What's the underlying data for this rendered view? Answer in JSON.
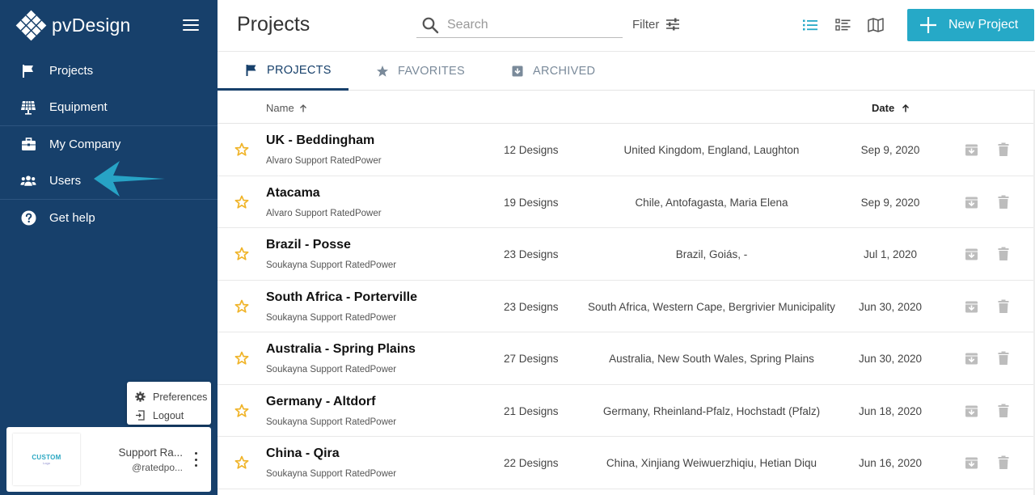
{
  "app": {
    "brand": "pvDesign"
  },
  "sidebar": {
    "items": [
      {
        "label": "Projects",
        "icon": "flag-icon"
      },
      {
        "label": "Equipment",
        "icon": "solar-panel-icon"
      },
      {
        "label": "My Company",
        "icon": "briefcase-icon"
      },
      {
        "label": "Users",
        "icon": "users-icon"
      },
      {
        "label": "Get help",
        "icon": "help-icon"
      }
    ],
    "pref_menu": {
      "preferences": "Preferences",
      "logout": "Logout"
    },
    "user": {
      "logo_text": "CUSTOM",
      "logo_sub": "Logo",
      "name": "Support Ra...",
      "email": "@ratedpo..."
    }
  },
  "header": {
    "title": "Projects",
    "search_placeholder": "Search",
    "filter_label": "Filter",
    "new_project_label": "New Project"
  },
  "tabs": [
    {
      "label": "PROJECTS",
      "active": true
    },
    {
      "label": "FAVORITES",
      "active": false
    },
    {
      "label": "ARCHIVED",
      "active": false
    }
  ],
  "table": {
    "columns": {
      "name": "Name",
      "date": "Date"
    },
    "rows": [
      {
        "name": "UK - Beddingham",
        "owner": "Alvaro Support RatedPower",
        "designs": "12 Designs",
        "location": "United Kingdom, England, Laughton",
        "date": "Sep 9, 2020"
      },
      {
        "name": "Atacama",
        "owner": "Alvaro Support RatedPower",
        "designs": "19 Designs",
        "location": "Chile, Antofagasta, Maria Elena",
        "date": "Sep 9, 2020"
      },
      {
        "name": "Brazil - Posse",
        "owner": "Soukayna Support RatedPower",
        "designs": "23 Designs",
        "location": "Brazil, Goiás, -",
        "date": "Jul 1, 2020"
      },
      {
        "name": "South Africa - Porterville",
        "owner": "Soukayna Support RatedPower",
        "designs": "23 Designs",
        "location": "South Africa, Western Cape, Bergrivier Municipality",
        "date": "Jun 30, 2020"
      },
      {
        "name": "Australia - Spring Plains",
        "owner": "Soukayna Support RatedPower",
        "designs": "27 Designs",
        "location": "Australia, New South Wales, Spring Plains",
        "date": "Jun 30, 2020"
      },
      {
        "name": "Germany - Altdorf",
        "owner": "Soukayna Support RatedPower",
        "designs": "21 Designs",
        "location": "Germany, Rheinland-Pfalz, Hochstadt (Pfalz)",
        "date": "Jun 18, 2020"
      },
      {
        "name": "China - Qira",
        "owner": "Soukayna Support RatedPower",
        "designs": "22 Designs",
        "location": "China, Xinjiang Weiwuerzhiqiu, Hetian Diqu",
        "date": "Jun 16, 2020"
      }
    ]
  },
  "colors": {
    "sidebar_bg": "#17406b",
    "accent": "#26a9c7",
    "star": "#f0b429",
    "arrow": "#27a3c5"
  }
}
